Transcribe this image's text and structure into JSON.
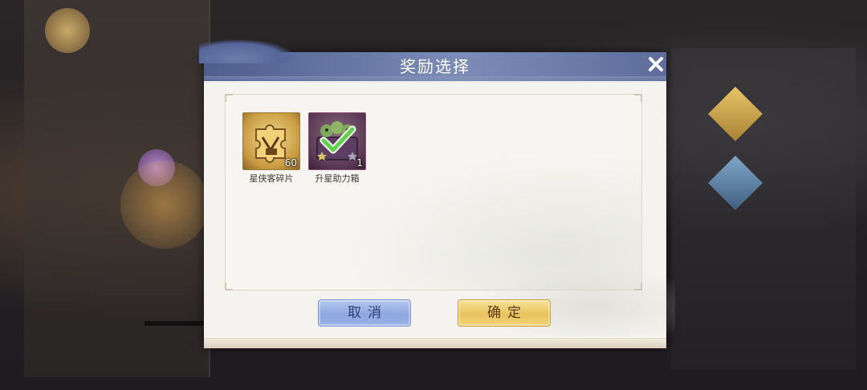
{
  "dialog": {
    "title": "奖励选择",
    "close_icon": "close-icon",
    "items": [
      {
        "name": "星侠客碎片",
        "count": "60",
        "icon": "puzzle-piece-icon",
        "selected": false
      },
      {
        "name": "升星助力箱",
        "count": "1",
        "icon": "star-box-icon",
        "selected": true,
        "selected_icon": "checkmark-icon"
      }
    ],
    "cancel_label": "取消",
    "confirm_label": "确定"
  },
  "colors": {
    "header": "#5d6d9c",
    "cancel_button": "#9bb2e6",
    "confirm_button": "#f0d37a",
    "check": "#5fd14a"
  }
}
